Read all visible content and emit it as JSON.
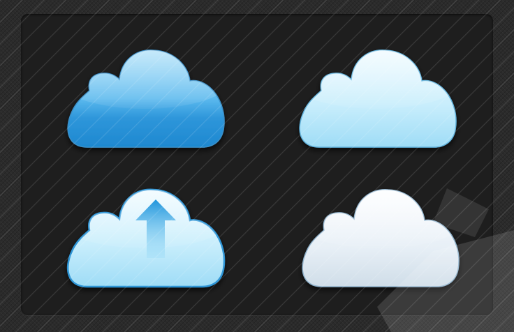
{
  "icons": [
    {
      "name": "cloud-icon-blue",
      "variant": "solid blue"
    },
    {
      "name": "cloud-icon-light-blue",
      "variant": "light blue"
    },
    {
      "name": "cloud-upload-icon",
      "variant": "light blue with upload arrow"
    },
    {
      "name": "cloud-icon-white",
      "variant": "white"
    }
  ],
  "colors": {
    "background": "#2b2b2b",
    "panel": "#1e1e1e",
    "blue_dark": "#1e88d0",
    "blue_mid": "#5bb9ee",
    "light_blue": "#c9eefc",
    "white_cloud": "#eef4f9",
    "arrow": "#2a9ee0"
  }
}
